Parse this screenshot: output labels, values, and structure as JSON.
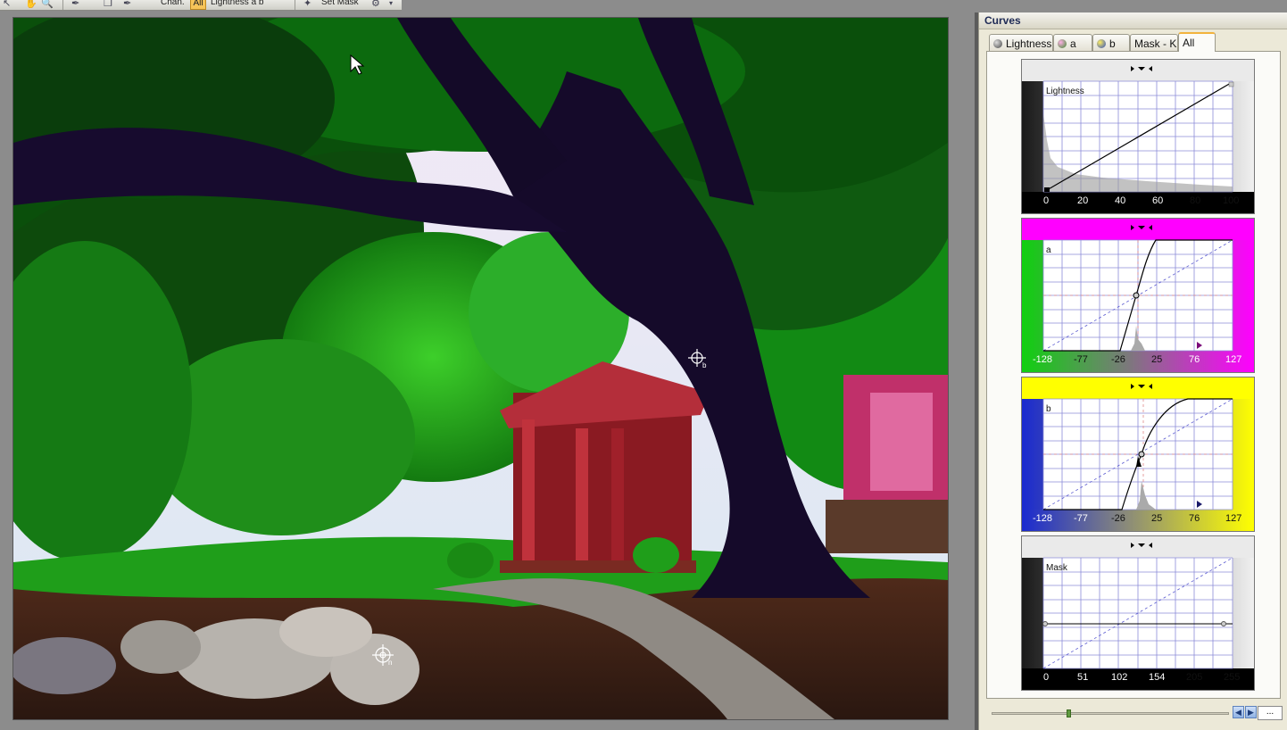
{
  "toolbar": {
    "chan_label": "Chan.",
    "all_label": "All",
    "channels_text": "Lightness  a  b",
    "set_mask_label": "Set Mask"
  },
  "panel": {
    "title": "Curves",
    "tabs": [
      {
        "label": "Lightness",
        "ball_color": "#6b6b6b"
      },
      {
        "label": "a",
        "ball_color": "#c0208a"
      },
      {
        "label": "b",
        "ball_color": "#3c9a2a"
      },
      {
        "label": "Mask - K",
        "ball_color": ""
      },
      {
        "label": "All",
        "ball_color": ""
      }
    ],
    "active_tab": "All",
    "curves": [
      {
        "channel": "Lightness",
        "ticks": [
          "0",
          "20",
          "40",
          "60",
          "80",
          "100"
        ]
      },
      {
        "channel": "a",
        "ticks": [
          "-128",
          "-77",
          "-26",
          "25",
          "76",
          "127"
        ]
      },
      {
        "channel": "b",
        "ticks": [
          "-128",
          "-77",
          "-26",
          "25",
          "76",
          "127"
        ]
      },
      {
        "channel": "Mask",
        "ticks": [
          "0",
          "51",
          "102",
          "154",
          "205",
          "255"
        ]
      }
    ],
    "more_button_label": "..."
  },
  "colors": {
    "panel_bg": "#ece9d8",
    "accent_tab": "#f2b33d",
    "a_channel": "#ff00ff",
    "b_channel": "#ffff00",
    "grid_line": "#8c8cd8"
  },
  "cursors": [
    "pointer",
    "sample-point-b",
    "sample-point-n"
  ]
}
